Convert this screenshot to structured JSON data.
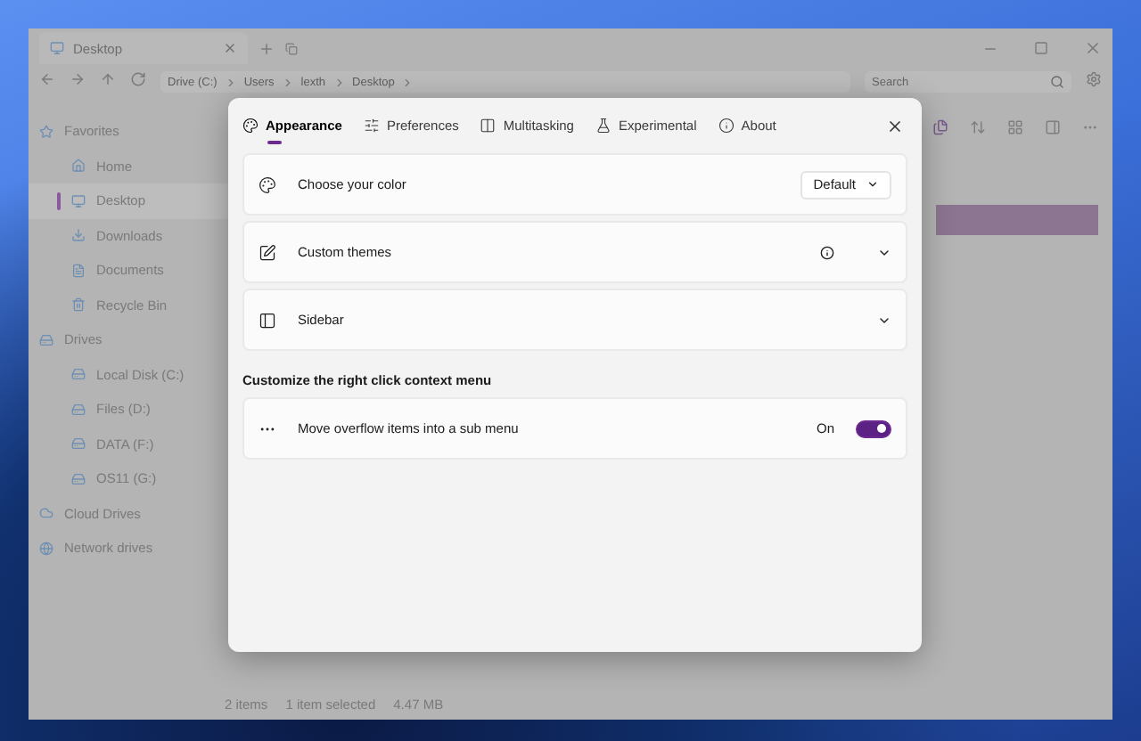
{
  "explorer": {
    "tab": {
      "title": "Desktop"
    },
    "breadcrumb": [
      "Drive (C:)",
      "Users",
      "lexth",
      "Desktop"
    ],
    "search": {
      "placeholder": "Search"
    },
    "sidebar": [
      {
        "label": "Favorites",
        "kind": "favorites",
        "children": [
          {
            "label": "Home",
            "kind": "home",
            "selected": false
          },
          {
            "label": "Desktop",
            "kind": "desktop",
            "selected": true
          },
          {
            "label": "Downloads",
            "kind": "downloads",
            "selected": false
          },
          {
            "label": "Documents",
            "kind": "documents",
            "selected": false
          },
          {
            "label": "Recycle Bin",
            "kind": "bin",
            "selected": false
          }
        ]
      },
      {
        "label": "Drives",
        "kind": "drives",
        "children": [
          {
            "label": "Local Disk (C:)",
            "kind": "drive",
            "selected": false
          },
          {
            "label": "Files (D:)",
            "kind": "drive",
            "selected": false
          },
          {
            "label": "DATA (F:)",
            "kind": "drive",
            "selected": false
          },
          {
            "label": "OS11 (G:)",
            "kind": "drive",
            "selected": false
          }
        ]
      },
      {
        "label": "Cloud Drives",
        "kind": "cloud"
      },
      {
        "label": "Network drives",
        "kind": "network"
      }
    ],
    "status_bar": [
      "2 items",
      "1 item selected",
      "4.47 MB"
    ]
  },
  "dialog": {
    "tabs": [
      {
        "label": "Appearance",
        "kind": "appearance",
        "selected": true
      },
      {
        "label": "Preferences",
        "kind": "preferences",
        "selected": false
      },
      {
        "label": "Multitasking",
        "kind": "multitasking",
        "selected": false
      },
      {
        "label": "Experimental",
        "kind": "experimental",
        "selected": false
      },
      {
        "label": "About",
        "kind": "about",
        "selected": false
      }
    ],
    "settings": [
      {
        "kind": "dropdown",
        "label": "Choose your color",
        "value": "Default"
      },
      {
        "kind": "expander",
        "label": "Custom themes",
        "info": true
      },
      {
        "kind": "expander",
        "label": "Sidebar",
        "info": false
      }
    ],
    "section_title": "Customize the right click context menu",
    "context_settings": [
      {
        "kind": "toggle",
        "label": "Move overflow items into a sub menu",
        "state_text": "On",
        "on": true
      }
    ]
  }
}
